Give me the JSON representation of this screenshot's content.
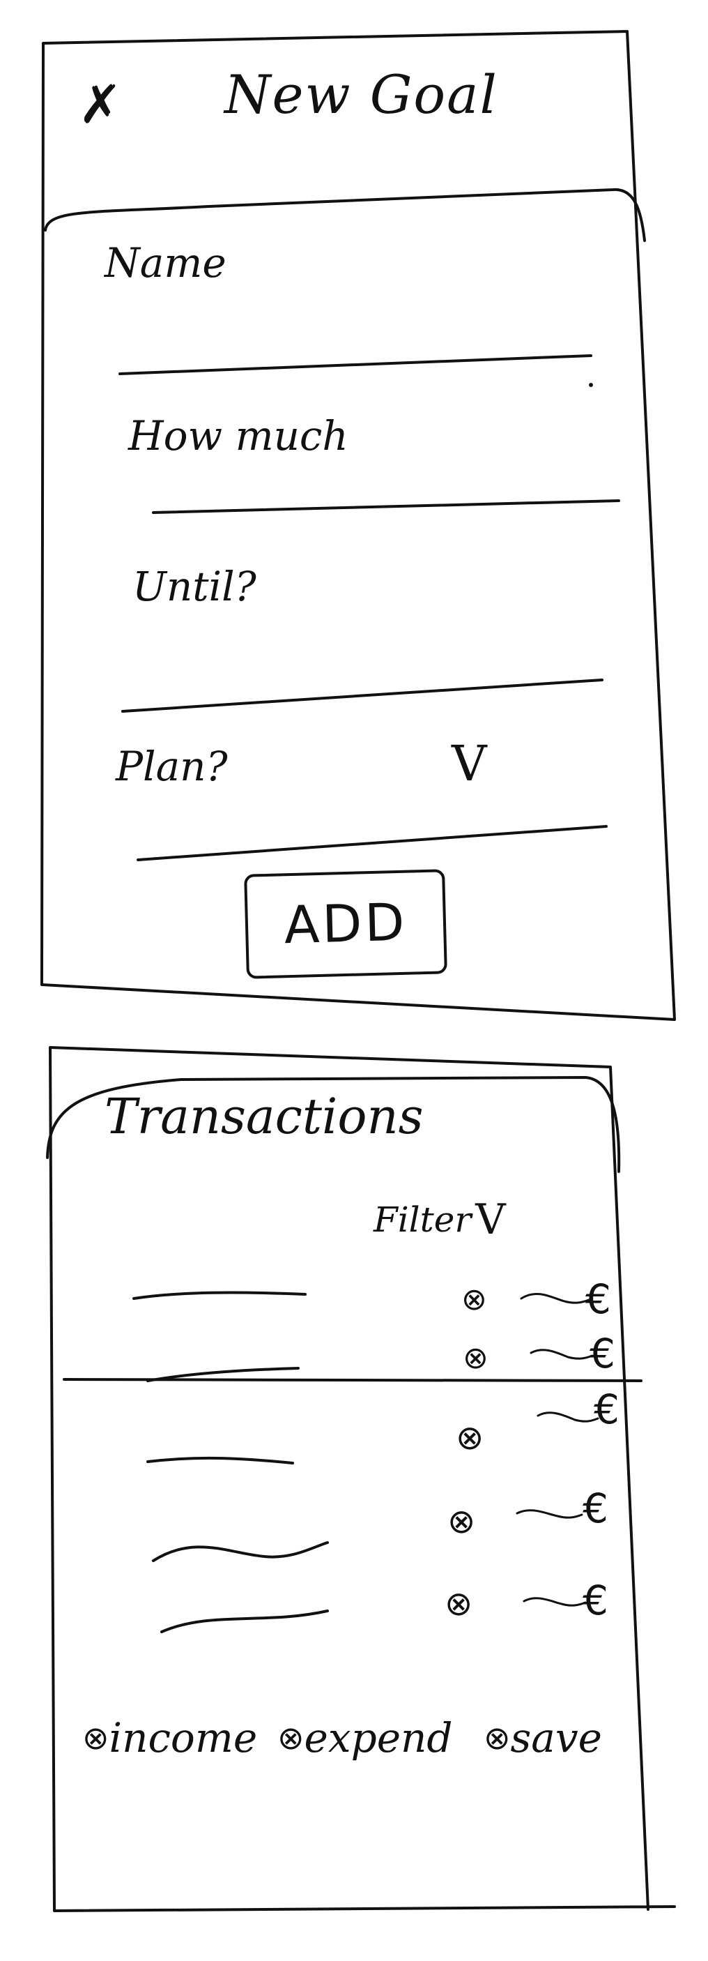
{
  "new_goal": {
    "close_icon": "close-icon",
    "title": "New Goal",
    "fields": [
      {
        "label": "Name",
        "value": ""
      },
      {
        "label": "How much",
        "value": ""
      },
      {
        "label": "Until?",
        "value": ""
      },
      {
        "label": "Plan?",
        "value": ""
      }
    ],
    "plan_dropdown_icon": "chevron-down-icon",
    "add_button": "ADD"
  },
  "transactions": {
    "title": "Transactions",
    "filter_label": "Filter",
    "filter_icon": "chevron-down-icon",
    "rows": [
      {
        "currency": "€"
      },
      {
        "currency": "€"
      },
      {
        "currency": "€"
      },
      {
        "currency": "€"
      },
      {
        "currency": "€"
      }
    ],
    "legend": [
      {
        "label": "income"
      },
      {
        "label": "expend"
      },
      {
        "label": "save"
      }
    ]
  }
}
